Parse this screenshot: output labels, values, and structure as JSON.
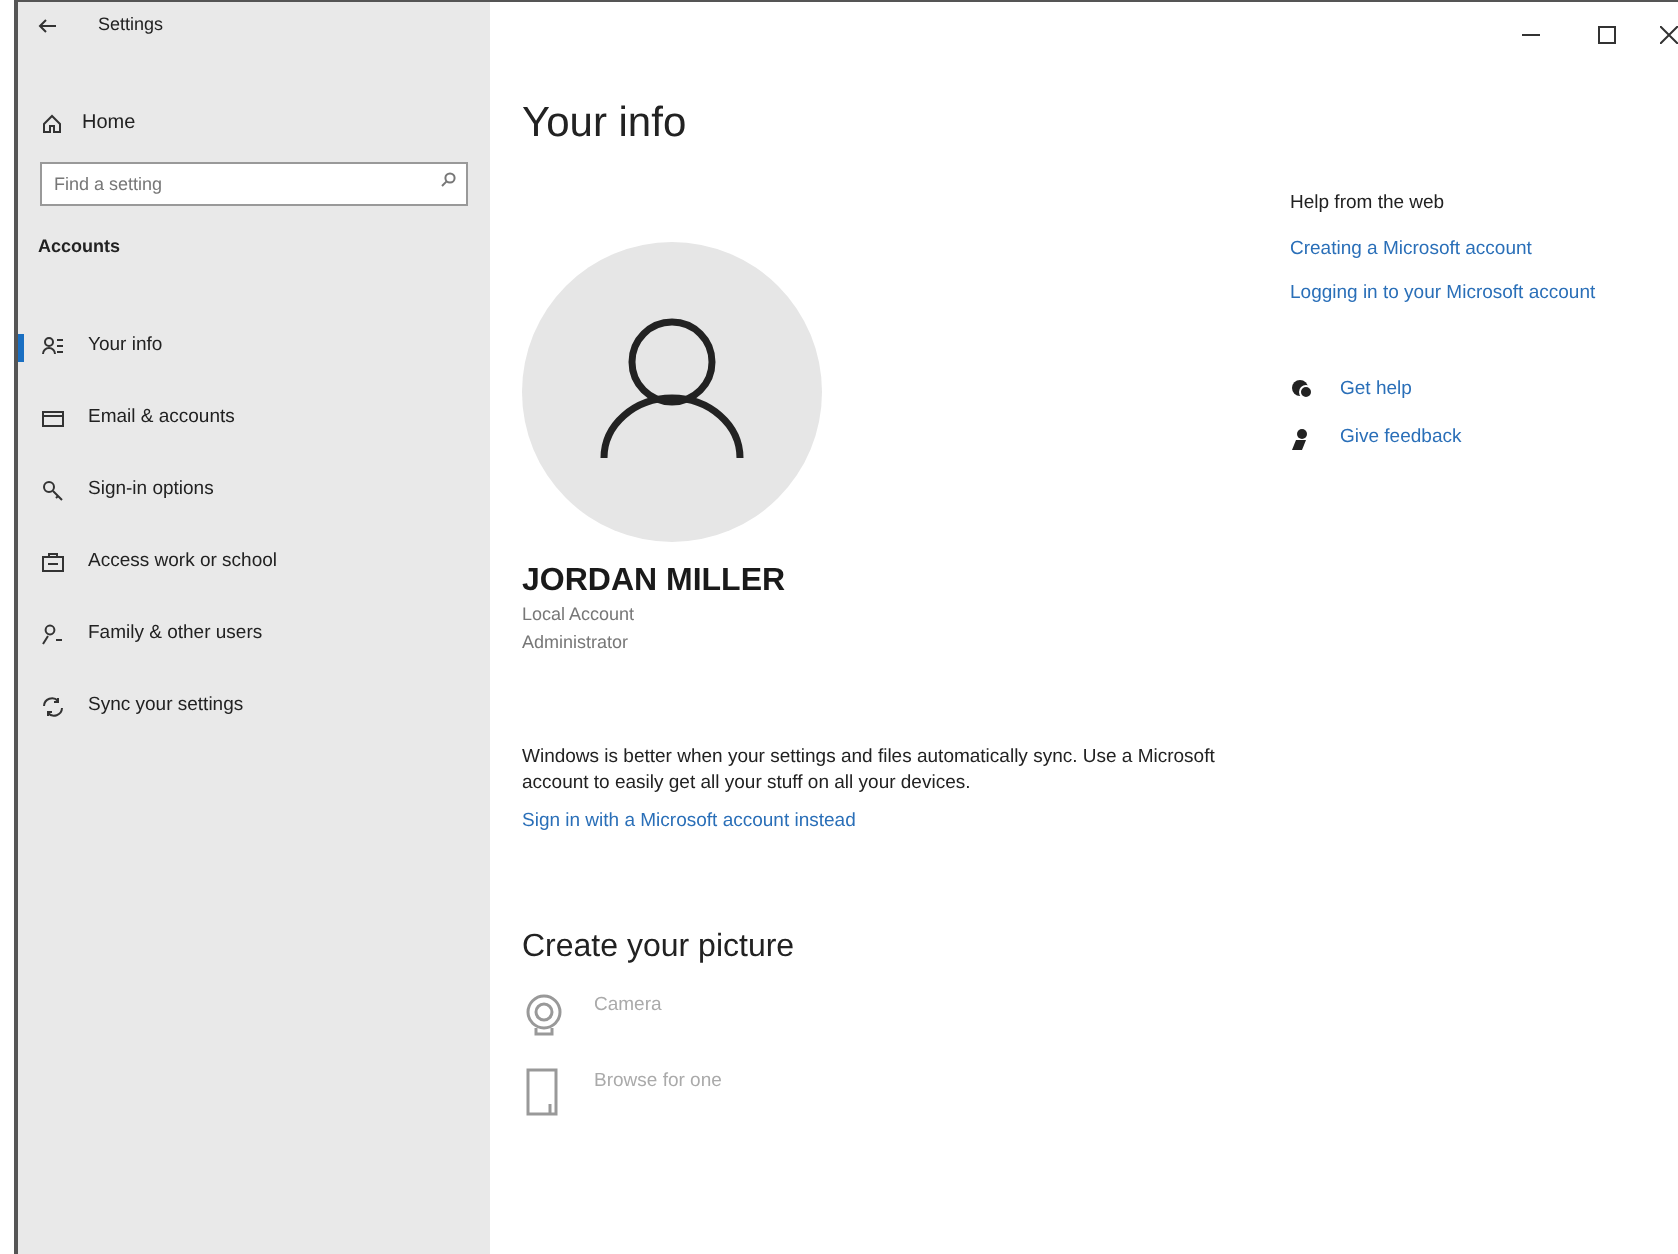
{
  "window": {
    "title": "Settings"
  },
  "sidebar": {
    "home": "Home",
    "search": {
      "placeholder": "Find a setting"
    },
    "section": "Accounts",
    "items": [
      {
        "label": "Your info",
        "kind": "profile",
        "selected": true
      },
      {
        "label": "Email & accounts",
        "kind": "mail",
        "selected": false
      },
      {
        "label": "Sign-in options",
        "kind": "key",
        "selected": false
      },
      {
        "label": "Access work or school",
        "kind": "briefcase",
        "selected": false
      },
      {
        "label": "Family & other users",
        "kind": "family",
        "selected": false
      },
      {
        "label": "Sync your settings",
        "kind": "sync",
        "selected": false
      }
    ]
  },
  "page": {
    "title": "Your info",
    "name": "JORDAN MILLER",
    "account_type": "Local Account",
    "role": "Administrator",
    "sync_text": "Windows is better when your settings and files automatically sync. Use a Microsoft account to easily get all your stuff on all your devices.",
    "sign_in_link": "Sign in with a Microsoft account instead",
    "picture_heading": "Create your picture",
    "picture_options": [
      {
        "label": "Camera",
        "kind": "camera",
        "disabled": true
      },
      {
        "label": "Browse for one",
        "kind": "browse",
        "disabled": true
      }
    ]
  },
  "help": {
    "heading": "Help from the web",
    "links": [
      "Creating a Microsoft account",
      "Logging in to your Microsoft account"
    ],
    "actions": [
      {
        "label": "Get help",
        "kind": "help"
      },
      {
        "label": "Give feedback",
        "kind": "feedback"
      }
    ]
  }
}
